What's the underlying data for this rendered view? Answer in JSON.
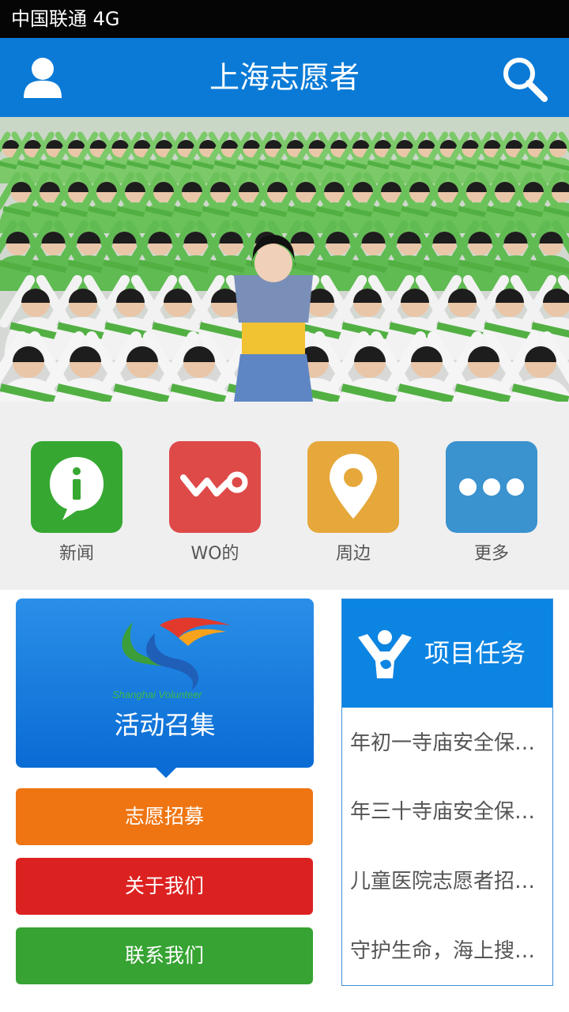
{
  "status_bar": {
    "carrier": "中国联通 4G"
  },
  "header": {
    "title": "上海志愿者",
    "user_icon": "user-icon",
    "search_icon": "search-icon"
  },
  "banner": {
    "slides_total": 4,
    "active_slide": 1
  },
  "quick_menu": [
    {
      "label": "新闻",
      "icon": "info-icon",
      "color": "#36a832"
    },
    {
      "label": "WO的",
      "icon": "wo-icon",
      "color": "#de4a48"
    },
    {
      "label": "周边",
      "icon": "location-pin-icon",
      "color": "#e6a83b"
    },
    {
      "label": "更多",
      "icon": "more-icon",
      "color": "#3a92cf"
    }
  ],
  "activity": {
    "title": "活动召集",
    "logo_text": "Shanghai Volunteer"
  },
  "actions": {
    "recruit": "志愿招募",
    "about": "关于我们",
    "contact": "联系我们"
  },
  "tasks": {
    "title": "项目任务",
    "items": [
      "年初一寺庙安全保…",
      "年三十寺庙安全保…",
      "儿童医院志愿者招…",
      "守护生命，海上搜…"
    ]
  }
}
